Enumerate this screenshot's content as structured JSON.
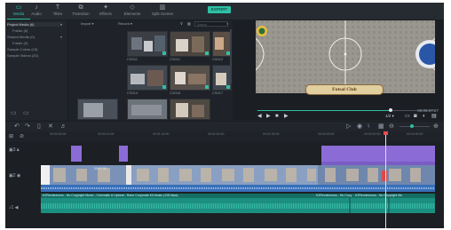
{
  "topbar": {
    "tabs": [
      {
        "label": "Media",
        "icon": "folder-icon"
      },
      {
        "label": "Audio",
        "icon": "music-icon"
      },
      {
        "label": "Titles",
        "icon": "text-icon"
      },
      {
        "label": "Transition",
        "icon": "transition-icon"
      },
      {
        "label": "Effects",
        "icon": "effects-icon"
      },
      {
        "label": "Elements",
        "icon": "elements-icon"
      },
      {
        "label": "Split Screen",
        "icon": "split-screen-icon"
      }
    ],
    "export_label": "EXPORT"
  },
  "sidebar": {
    "items": [
      {
        "label": "Project Media (6)"
      },
      {
        "label": "Folder (6)"
      },
      {
        "label": "Shared Media (0)"
      },
      {
        "label": "Folder (0)"
      },
      {
        "label": "Sample Colors (15)"
      },
      {
        "label": "Sample Videos (20)"
      }
    ]
  },
  "media": {
    "import_label": "Import",
    "record_label": "Record",
    "search_placeholder": "Search",
    "clips": [
      {
        "name": "CS011"
      },
      {
        "name": "CS011"
      },
      {
        "name": "CS012"
      },
      {
        "name": "CS014"
      },
      {
        "name": "CS016"
      },
      {
        "name": "CS017"
      }
    ]
  },
  "preview": {
    "caption": "Futsal Club",
    "timecode": "00:05:07:27",
    "ratio": "1/2",
    "progress": 0.75
  },
  "timeline": {
    "ruler_ticks": [
      "00:00:00:00",
      "00:00:10:00",
      "00:01:40:00",
      "00:02:00:00",
      "00:02:30:00",
      "00:03:00:00",
      "00:03:20:00",
      "00:04:00:00"
    ],
    "audio_clip_1": "K2Rendezvous - No Copyright Music - Cinematic & Upbeat - Rotor Corporate Kit Music (128 kbps)",
    "audio_clip_2": "K2Rendezvous - No Copyright Mu",
    "audio_clip_3": "K2Rendezvous - No Copyright Mu",
    "video_clip_label": "00:07:35",
    "tracks": [
      {
        "label": "3"
      },
      {
        "label": "2"
      },
      {
        "label": "1"
      }
    ]
  },
  "colors": {
    "accent": "#2ec0a4",
    "video_track": "#8b6bd6",
    "audio_track": "#1c8f80",
    "clip": "#5b8dd6"
  }
}
